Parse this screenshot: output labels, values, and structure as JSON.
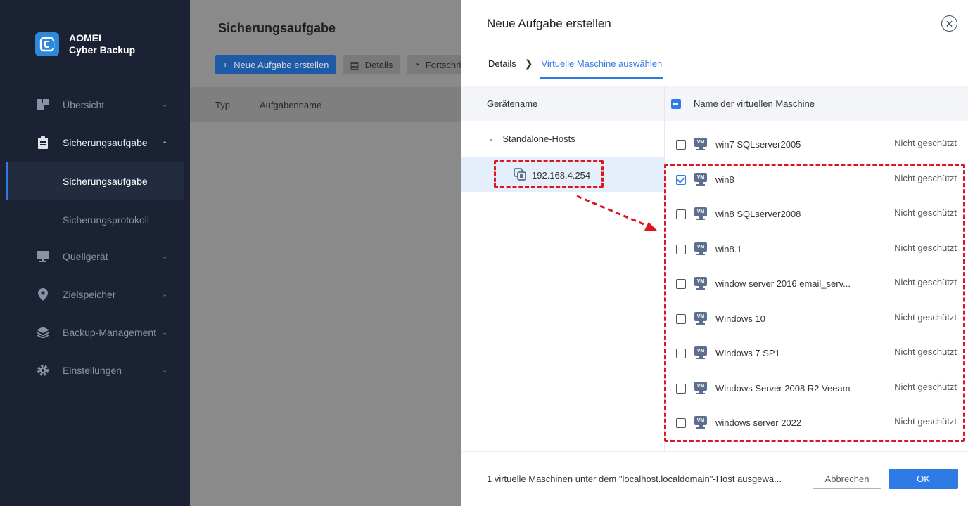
{
  "brand": {
    "line1": "AOMEI",
    "line2": "Cyber Backup",
    "color": "#2c8ad8"
  },
  "sidebar": {
    "items": [
      {
        "label": "Übersicht",
        "icon": "dashboard-icon"
      },
      {
        "label": "Sicherungsaufgabe",
        "icon": "clipboard-icon",
        "expanded": true
      },
      {
        "label": "Quellgerät",
        "icon": "monitor-icon"
      },
      {
        "label": "Zielspeicher",
        "icon": "location-pin-icon"
      },
      {
        "label": "Backup-Management",
        "icon": "layers-icon"
      },
      {
        "label": "Einstellungen",
        "icon": "gear-icon"
      }
    ],
    "subitems": [
      {
        "label": "Sicherungsaufgabe",
        "active": true
      },
      {
        "label": "Sicherungsprotokoll",
        "active": false
      }
    ]
  },
  "main": {
    "title": "Sicherungsaufgabe",
    "toolbar": {
      "new_task": "Neue Aufgabe erstellen",
      "details": "Details",
      "progress": "Fortschritt"
    },
    "columns": [
      "Typ",
      "Aufgabenname"
    ]
  },
  "dialog": {
    "title": "Neue Aufgabe erstellen",
    "steps": [
      "Details",
      "Virtuelle Maschine auswählen"
    ],
    "left_header": "Gerätename",
    "right_header": "Name der virtuellen Maschine",
    "tree": {
      "group": "Standalone-Hosts",
      "host": "192.168.4.254"
    },
    "vms": [
      {
        "name": "win7 SQLserver2005",
        "status": "Nicht geschützt",
        "checked": false
      },
      {
        "name": "win8",
        "status": "Nicht geschützt",
        "checked": true
      },
      {
        "name": "win8 SQLserver2008",
        "status": "Nicht geschützt",
        "checked": false
      },
      {
        "name": "win8.1",
        "status": "Nicht geschützt",
        "checked": false
      },
      {
        "name": "window server 2016 email_serv...",
        "status": "Nicht geschützt",
        "checked": false
      },
      {
        "name": "Windows 10",
        "status": "Nicht geschützt",
        "checked": false
      },
      {
        "name": "Windows 7 SP1",
        "status": "Nicht geschützt",
        "checked": false
      },
      {
        "name": "Windows Server 2008 R2 Veeam",
        "status": "Nicht geschützt",
        "checked": false
      },
      {
        "name": "windows server 2022",
        "status": "Nicht geschützt",
        "checked": false
      }
    ],
    "vm_badge": "VM",
    "footer_text": "1 virtuelle Maschinen unter dem \"localhost.localdomain\"-Host ausgewä...",
    "cancel_label": "Abbrechen",
    "ok_label": "OK"
  },
  "colors": {
    "accent": "#2e7be5",
    "sidebar_bg": "#1b2233",
    "annotation": "#e0141e"
  }
}
